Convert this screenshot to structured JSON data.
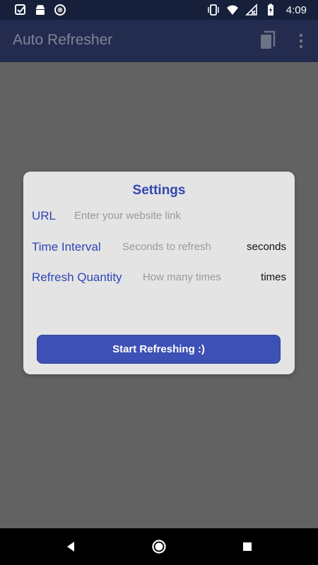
{
  "status_bar": {
    "time": "4:09",
    "left_icons": [
      "checkbox-icon",
      "android-icon",
      "circle-dots-icon"
    ],
    "right_icons": [
      "vibrate-icon",
      "wifi-icon",
      "no-signal-icon",
      "battery-charging-icon"
    ]
  },
  "app_bar": {
    "title": "Auto Refresher",
    "actions": [
      "copy-icon",
      "more-vert-icon"
    ]
  },
  "dialog": {
    "title": "Settings",
    "rows": [
      {
        "label": "URL",
        "placeholder": "Enter your website link",
        "unit": ""
      },
      {
        "label": "Time Interval",
        "placeholder": "Seconds to refresh",
        "unit": "seconds"
      },
      {
        "label": "Refresh Quantity",
        "placeholder": "How many times",
        "unit": "times"
      }
    ],
    "button_label": "Start Refreshing :)"
  },
  "nav_bar": {
    "buttons": [
      "back-icon",
      "home-icon",
      "recents-icon"
    ]
  },
  "colors": {
    "accent": "#3d50b5",
    "label_blue": "#2f44b5",
    "app_bar": "#232b4f",
    "scrim": "#626262"
  }
}
